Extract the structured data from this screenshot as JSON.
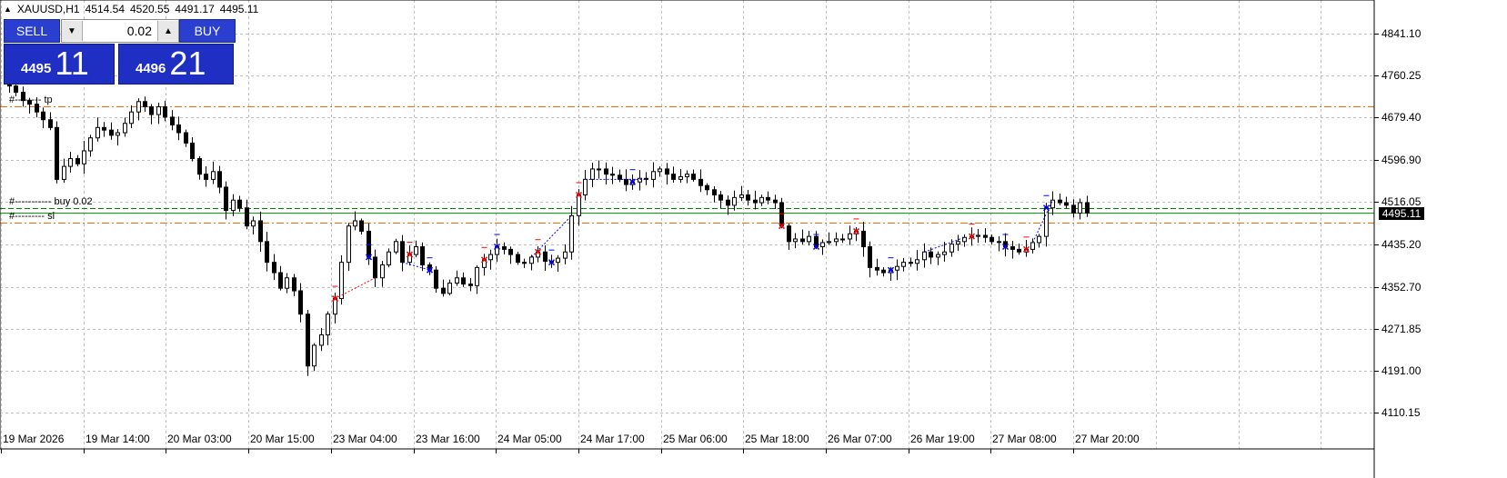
{
  "header": {
    "symbol": "XAUUSD,H1",
    "open": "4514.54",
    "high": "4520.55",
    "low": "4491.17",
    "close": "4495.11"
  },
  "trade_panel": {
    "sell_label": "SELL",
    "buy_label": "BUY",
    "lot_value": "0.02",
    "sell_price_base": "4495",
    "sell_price_big": "11",
    "buy_price_base": "4496",
    "buy_price_big": "21"
  },
  "order_labels": {
    "tp_label": "#-------- tp",
    "buy_label": "#----------- buy 0.02",
    "sl_label": "#--------- sl"
  },
  "current_price": "4495.11",
  "colors": {
    "sell_buy_blue": "#2a3fd0",
    "price_box_blue": "#1f2fc4",
    "tp_sl_line": "#ff6a00",
    "entry_line": "#008000",
    "bid_line": "#00aa00",
    "grid": "#c0c0c0",
    "marker_red": "#ff0000",
    "marker_blue": "#0000ff"
  },
  "icons": {
    "lot_down": "chevron-down-icon",
    "lot_up": "chevron-up-icon",
    "collapse": "triangle-up-icon"
  },
  "chart_data": {
    "type": "candlestick",
    "symbol": "XAUUSD",
    "timeframe": "H1",
    "x_labels": [
      "19 Mar 2026",
      "19 Mar 14:00",
      "20 Mar 03:00",
      "20 Mar 15:00",
      "23 Mar 04:00",
      "23 Mar 16:00",
      "24 Mar 05:00",
      "24 Mar 17:00",
      "25 Mar 06:00",
      "25 Mar 18:00",
      "26 Mar 07:00",
      "26 Mar 19:00",
      "27 Mar 08:00",
      "27 Mar 20:00"
    ],
    "y_labels": [
      "4841.10",
      "4760.25",
      "4679.40",
      "4596.90",
      "4516.05",
      "4435.20",
      "4352.70",
      "4271.85",
      "4191.00",
      "4110.15"
    ],
    "ylim": [
      4090,
      4880
    ],
    "grid": true,
    "closes": [
      4740,
      4728,
      4712,
      4705,
      4690,
      4675,
      4660,
      4560,
      4585,
      4600,
      4590,
      4615,
      4640,
      4660,
      4655,
      4645,
      4650,
      4668,
      4690,
      4710,
      4700,
      4685,
      4700,
      4680,
      4665,
      4650,
      4630,
      4600,
      4570,
      4560,
      4575,
      4545,
      4500,
      4520,
      4505,
      4470,
      4480,
      4440,
      4400,
      4380,
      4350,
      4370,
      4345,
      4300,
      4200,
      4240,
      4260,
      4300,
      4330,
      4400,
      4470,
      4480,
      4460,
      4410,
      4370,
      4395,
      4420,
      4440,
      4400,
      4415,
      4430,
      4395,
      4385,
      4350,
      4340,
      4360,
      4370,
      4358,
      4355,
      4390,
      4405,
      4415,
      4430,
      4425,
      4415,
      4400,
      4398,
      4410,
      4420,
      4402,
      4400,
      4408,
      4420,
      4490,
      4530,
      4560,
      4580,
      4580,
      4570,
      4568,
      4560,
      4550,
      4555,
      4562,
      4560,
      4575,
      4580,
      4570,
      4560,
      4565,
      4570,
      4560,
      4548,
      4540,
      4530,
      4520,
      4510,
      4525,
      4530,
      4520,
      4515,
      4525,
      4520,
      4515,
      4470,
      4440,
      4445,
      4440,
      4450,
      4430,
      4438,
      4440,
      4445,
      4445,
      4455,
      4460,
      4430,
      4390,
      4385,
      4380,
      4385,
      4392,
      4400,
      4398,
      4405,
      4420,
      4410,
      4415,
      4420,
      4435,
      4440,
      4448,
      4450,
      4452,
      4448,
      4440,
      4440,
      4430,
      4425,
      4420,
      4425,
      4438,
      4450,
      4505,
      4520,
      4515,
      4510,
      4495,
      4515,
      4495
    ]
  }
}
